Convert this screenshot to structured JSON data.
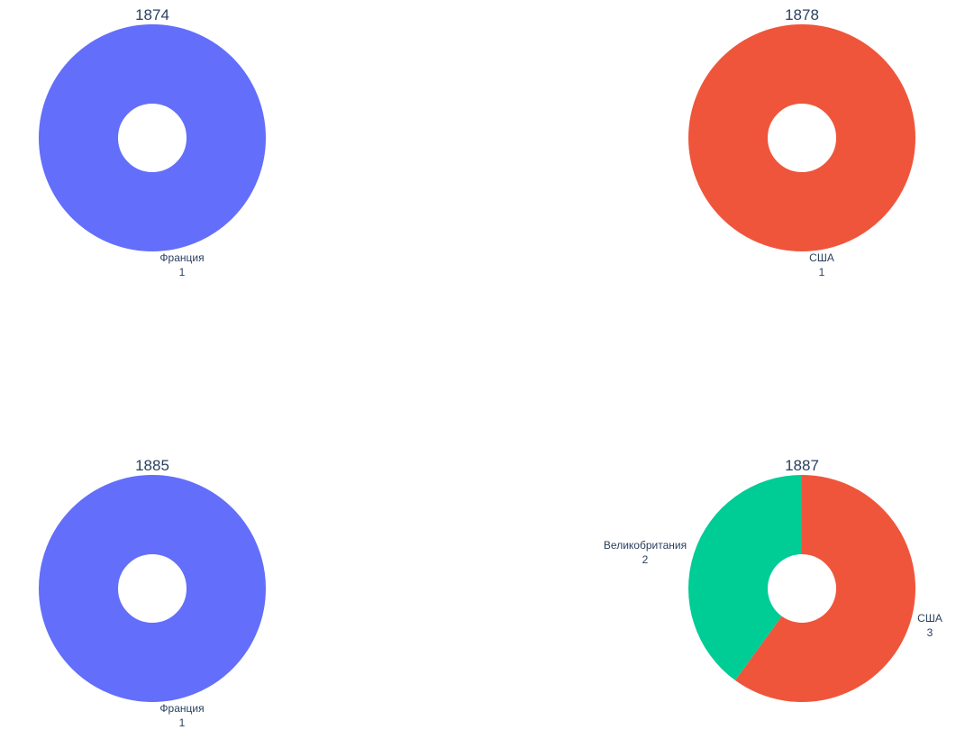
{
  "chart_data": [
    {
      "type": "pie",
      "hole": true,
      "title": "1874",
      "slices": [
        {
          "label": "Франция",
          "value": 1,
          "color": "#636efa"
        }
      ]
    },
    {
      "type": "pie",
      "hole": true,
      "title": "1878",
      "slices": [
        {
          "label": "США",
          "value": 1,
          "color": "#ef553b"
        }
      ]
    },
    {
      "type": "pie",
      "hole": true,
      "title": "1885",
      "slices": [
        {
          "label": "Франция",
          "value": 1,
          "color": "#636efa"
        }
      ]
    },
    {
      "type": "pie",
      "hole": true,
      "title": "1887",
      "slices": [
        {
          "label": "США",
          "value": 3,
          "color": "#ef553b"
        },
        {
          "label": "Великобритания",
          "value": 2,
          "color": "#00cc96"
        }
      ]
    }
  ]
}
